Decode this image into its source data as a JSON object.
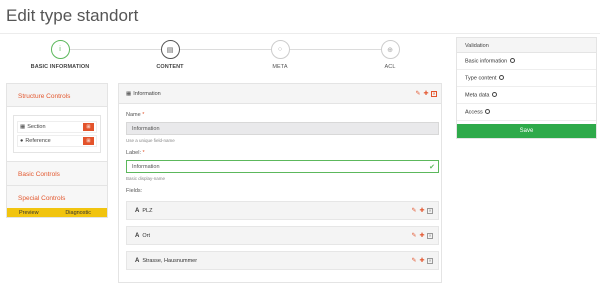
{
  "page": {
    "title": "Edit type standort"
  },
  "stepper": {
    "steps": [
      {
        "label": "BASIC INFORMATION",
        "icon_glyph": "i",
        "state": "active"
      },
      {
        "label": "CONTENT",
        "icon_glyph": "▤",
        "state": "current"
      },
      {
        "label": "META",
        "icon_glyph": "○",
        "state": "todo"
      },
      {
        "label": "ACL",
        "icon_glyph": "⊕",
        "state": "todo"
      }
    ]
  },
  "sidebar": {
    "structure_title": "Structure Controls",
    "controls": [
      {
        "label": "Section",
        "icon": "section-icon"
      },
      {
        "label": "Reference",
        "icon": "reference-icon"
      }
    ],
    "basic_title": "Basic Controls",
    "special_title": "Special Controls",
    "footer": {
      "preview": "Preview",
      "diagnostic": "Diagnostic"
    }
  },
  "main": {
    "header": "Information",
    "name_label": "Name",
    "name_value": "Information",
    "name_help": "Use a unique field-name",
    "label_label": "Label:",
    "label_value": "Information",
    "label_help": "Basic display-name",
    "fields_label": "Fields:",
    "fields": [
      {
        "name": "PLZ"
      },
      {
        "name": "Ort"
      },
      {
        "name": "Strasse, Hausnummer"
      }
    ]
  },
  "validation": {
    "title": "Validation",
    "items": [
      {
        "label": "Basic information"
      },
      {
        "label": "Type content"
      },
      {
        "label": "Meta data"
      },
      {
        "label": "Access"
      }
    ],
    "save_label": "Save"
  },
  "colors": {
    "accent": "#e3582f",
    "success": "#2eaa4a",
    "warning_bar": "#f1c40f"
  }
}
